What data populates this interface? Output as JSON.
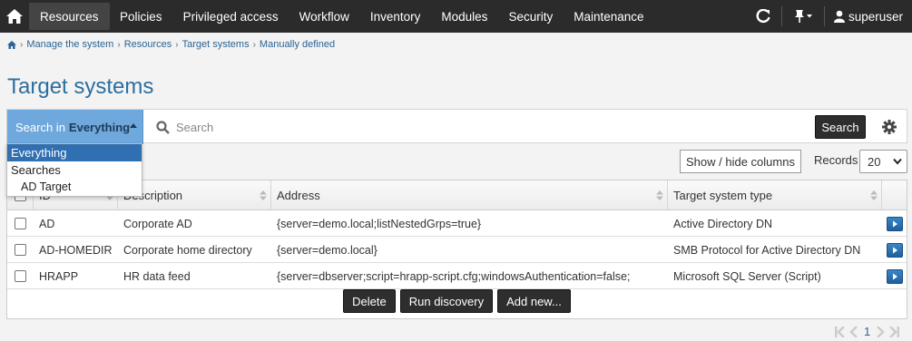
{
  "nav": {
    "items": [
      "Resources",
      "Policies",
      "Privileged access",
      "Workflow",
      "Inventory",
      "Modules",
      "Security",
      "Maintenance"
    ],
    "user": "superuser"
  },
  "breadcrumb": [
    "Manage the system",
    "Resources",
    "Target systems",
    "Manually defined"
  ],
  "page_title": "Target systems",
  "search": {
    "scope_label": "Search in",
    "scope_value": "Everything",
    "placeholder": "Search",
    "button": "Search"
  },
  "dropdown": {
    "options": [
      "Everything",
      "Searches",
      "AD Target"
    ]
  },
  "controls": {
    "show_hide": "Show / hide columns",
    "records_label": "Records",
    "records_value": "20"
  },
  "table": {
    "headers": [
      "ID",
      "Description",
      "Address",
      "Target system type"
    ],
    "rows": [
      {
        "id": "AD",
        "description": "Corporate AD",
        "address": "{server=demo.local;listNestedGrps=true}",
        "type": "Active Directory DN"
      },
      {
        "id": "AD-HOMEDIR",
        "description": "Corporate home directory",
        "address": "{server=demo.local}",
        "type": "SMB Protocol for Active Directory DN"
      },
      {
        "id": "HRAPP",
        "description": "HR data feed",
        "address": "{server=dbserver;script=hrapp-script.cfg;windowsAuthentication=false;",
        "type": "Microsoft SQL Server (Script)"
      }
    ]
  },
  "actions": [
    "Delete",
    "Run discovery",
    "Add new..."
  ],
  "pagination": {
    "page": "1"
  },
  "colors": {
    "nav_bg": "#2b2b2b",
    "title": "#2c6e9e",
    "scope_bg": "#6fa8dc",
    "selected": "#2f6fb2"
  }
}
